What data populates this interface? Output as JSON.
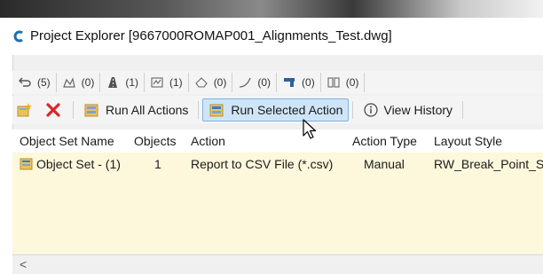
{
  "window": {
    "title": "Project Explorer [9667000ROMAP001_Alignments_Test.dwg]"
  },
  "tabs": [
    {
      "count": "(5)",
      "icon": "undo-arrow-icon"
    },
    {
      "count": "(0)",
      "icon": "surface-icon"
    },
    {
      "count": "(1)",
      "icon": "alignment-icon"
    },
    {
      "count": "(1)",
      "icon": "profile-icon"
    },
    {
      "count": "(0)",
      "icon": "parcel-icon"
    },
    {
      "count": "(0)",
      "icon": "curve-icon"
    },
    {
      "count": "(0)",
      "icon": "corridor-icon"
    },
    {
      "count": "(0)",
      "icon": "pipe-network-icon"
    }
  ],
  "toolbar": {
    "run_all_label": "Run All Actions",
    "run_selected_label": "Run Selected Action",
    "view_history_label": "View History"
  },
  "table": {
    "columns": [
      "Object Set Name",
      "Objects",
      "Action",
      "Action Type",
      "Layout Style"
    ],
    "rows": [
      {
        "name": "Object Set - (1)",
        "objects": "1",
        "action": "Report to CSV File (*.csv)",
        "action_type": "Manual",
        "layout_style": "RW_Break_Point_S"
      }
    ]
  },
  "scrollbar": {
    "left_arrow": "<"
  },
  "colors": {
    "selected_button_bg": "#cfe5f7",
    "row_bg": "#fdf7dc",
    "delete_red": "#d9262b"
  }
}
